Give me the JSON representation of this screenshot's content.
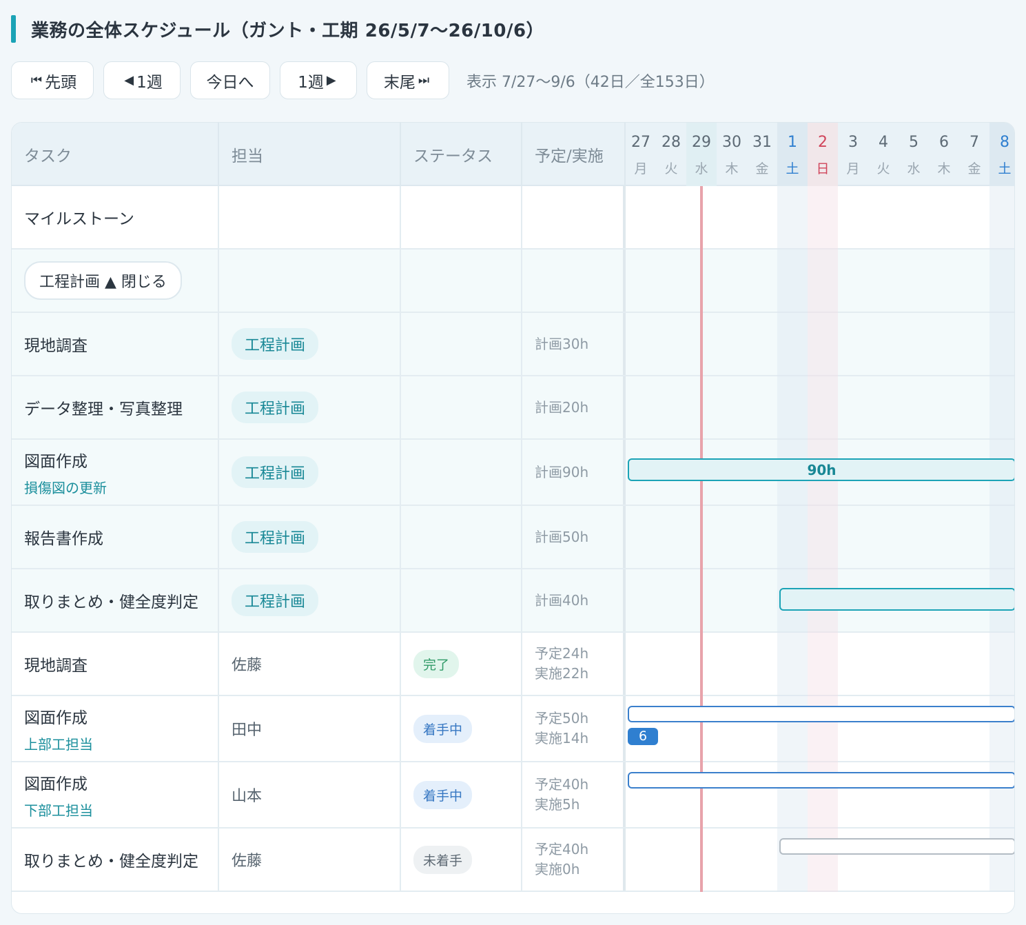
{
  "title": "業務の全体スケジュール（ガント・工期 26/5/7〜26/10/6）",
  "toolbar": {
    "first": {
      "glyph": "⏮",
      "label": "先頭"
    },
    "prev": {
      "glyph": "◀",
      "label": "1週"
    },
    "today": "今日へ",
    "next": {
      "label": "1週",
      "glyph": "▶"
    },
    "last": {
      "label": "末尾",
      "glyph": "⏭"
    },
    "range": "表示 7/27〜9/6（42日／全153日）"
  },
  "columns": {
    "task": "タスク",
    "assignee": "担当",
    "status": "ステータス",
    "hours": "予定/実施"
  },
  "days": [
    {
      "num": "27",
      "wd": "月",
      "type": "normal"
    },
    {
      "num": "28",
      "wd": "火",
      "type": "normal"
    },
    {
      "num": "29",
      "wd": "水",
      "type": "today"
    },
    {
      "num": "30",
      "wd": "木",
      "type": "normal"
    },
    {
      "num": "31",
      "wd": "金",
      "type": "normal"
    },
    {
      "num": "1",
      "wd": "土",
      "type": "sat"
    },
    {
      "num": "2",
      "wd": "日",
      "type": "sun"
    },
    {
      "num": "3",
      "wd": "月",
      "type": "normal"
    },
    {
      "num": "4",
      "wd": "火",
      "type": "normal"
    },
    {
      "num": "5",
      "wd": "水",
      "type": "normal"
    },
    {
      "num": "6",
      "wd": "木",
      "type": "normal"
    },
    {
      "num": "7",
      "wd": "金",
      "type": "normal"
    },
    {
      "num": "8",
      "wd": "土",
      "type": "sat"
    }
  ],
  "milestone_label": "マイルストーン",
  "group_toggle": "工程計画 ▲ 閉じる",
  "phase_rows": [
    {
      "name": "現地調査",
      "sub": "",
      "tag": "工程計画",
      "hours": "計画30h",
      "bar_label": ""
    },
    {
      "name": "データ整理・写真整理",
      "sub": "",
      "tag": "工程計画",
      "hours": "計画20h",
      "bar_label": ""
    },
    {
      "name": "図面作成",
      "sub": "損傷図の更新",
      "tag": "工程計画",
      "hours": "計画90h",
      "bar_label": "90h"
    },
    {
      "name": "報告書作成",
      "sub": "",
      "tag": "工程計画",
      "hours": "計画50h",
      "bar_label": ""
    },
    {
      "name": "取りまとめ・健全度判定",
      "sub": "",
      "tag": "工程計画",
      "hours": "計画40h",
      "bar_label": ""
    }
  ],
  "task_rows": [
    {
      "name": "現地調査",
      "sub": "",
      "assignee": "佐藤",
      "status": "完了",
      "planned": "予定24h",
      "actual": "実施22h",
      "chip": ""
    },
    {
      "name": "図面作成",
      "sub": "上部工担当",
      "assignee": "田中",
      "status": "着手中",
      "planned": "予定50h",
      "actual": "実施14h",
      "chip": "6"
    },
    {
      "name": "図面作成",
      "sub": "下部工担当",
      "assignee": "山本",
      "status": "着手中",
      "planned": "予定40h",
      "actual": "実施5h",
      "chip": ""
    },
    {
      "name": "取りまとめ・健全度判定",
      "sub": "",
      "assignee": "佐藤",
      "status": "未着手",
      "planned": "予定40h",
      "actual": "実施0h",
      "chip": ""
    }
  ],
  "colors": {
    "accent": "#1ba3b6",
    "today_line": "#e8a3ab",
    "sat": "#2f7fd0",
    "sun": "#d0445a",
    "status_done": "#2f9a67",
    "status_progress": "#3677c2",
    "status_todo": "#5d6973"
  }
}
